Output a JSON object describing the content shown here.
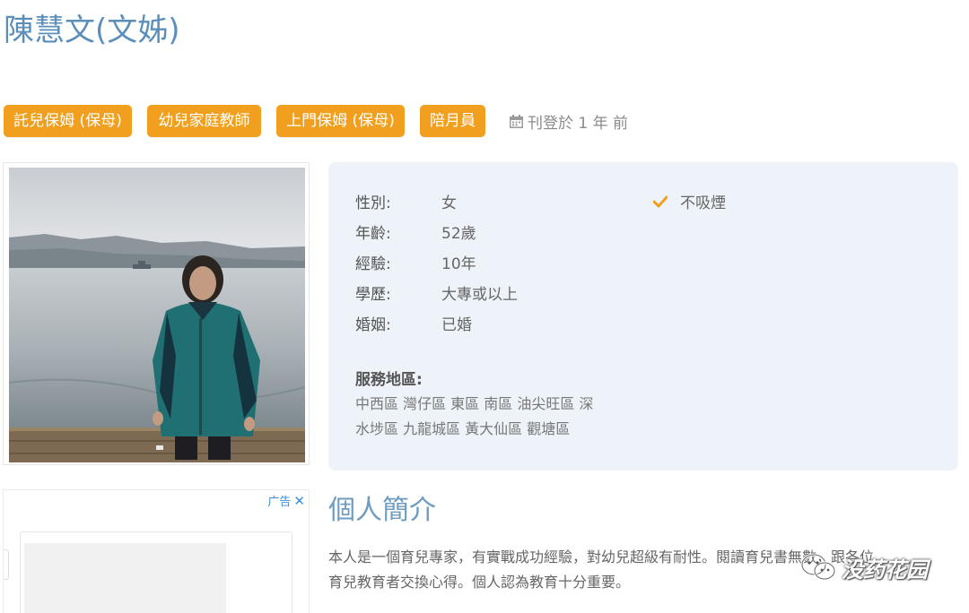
{
  "profile": {
    "name": "陳慧文(文姊)"
  },
  "tags": [
    "託兒保姆 (保母)",
    "幼兒家庭教師",
    "上門保姆 (保母)",
    "陪月員"
  ],
  "posted": "刊登於 1 年 前",
  "details": {
    "rows": [
      {
        "key": "性別:",
        "value": "女"
      },
      {
        "key": "年齡:",
        "value": "52歲"
      },
      {
        "key": "經驗:",
        "value": "10年"
      },
      {
        "key": "學歷:",
        "value": "大專或以上"
      },
      {
        "key": "婚姻:",
        "value": "已婚"
      }
    ],
    "no_smoking": "不吸煙",
    "service_area_label": "服務地區:",
    "service_area_lines": [
      "中西區 灣仔區 東區 南區 油尖旺區 深",
      "水埗區 九龍城區 黃大仙區 觀塘區"
    ]
  },
  "ad": {
    "label": "广告",
    "close": "✕"
  },
  "intro": {
    "title": "個人簡介",
    "lines": [
      "本人是一個育兒專家，有實戰成功經驗，對幼兒超級有耐性。閱讀育兒書無數，跟各位",
      "育兒教育者交換心得。個人認為教育十分重要。"
    ]
  },
  "watermark": {
    "text": "没药花园"
  },
  "colors": {
    "tag": "#f0a01e",
    "title": "#5b8fb9",
    "panel": "#eef3f9"
  }
}
